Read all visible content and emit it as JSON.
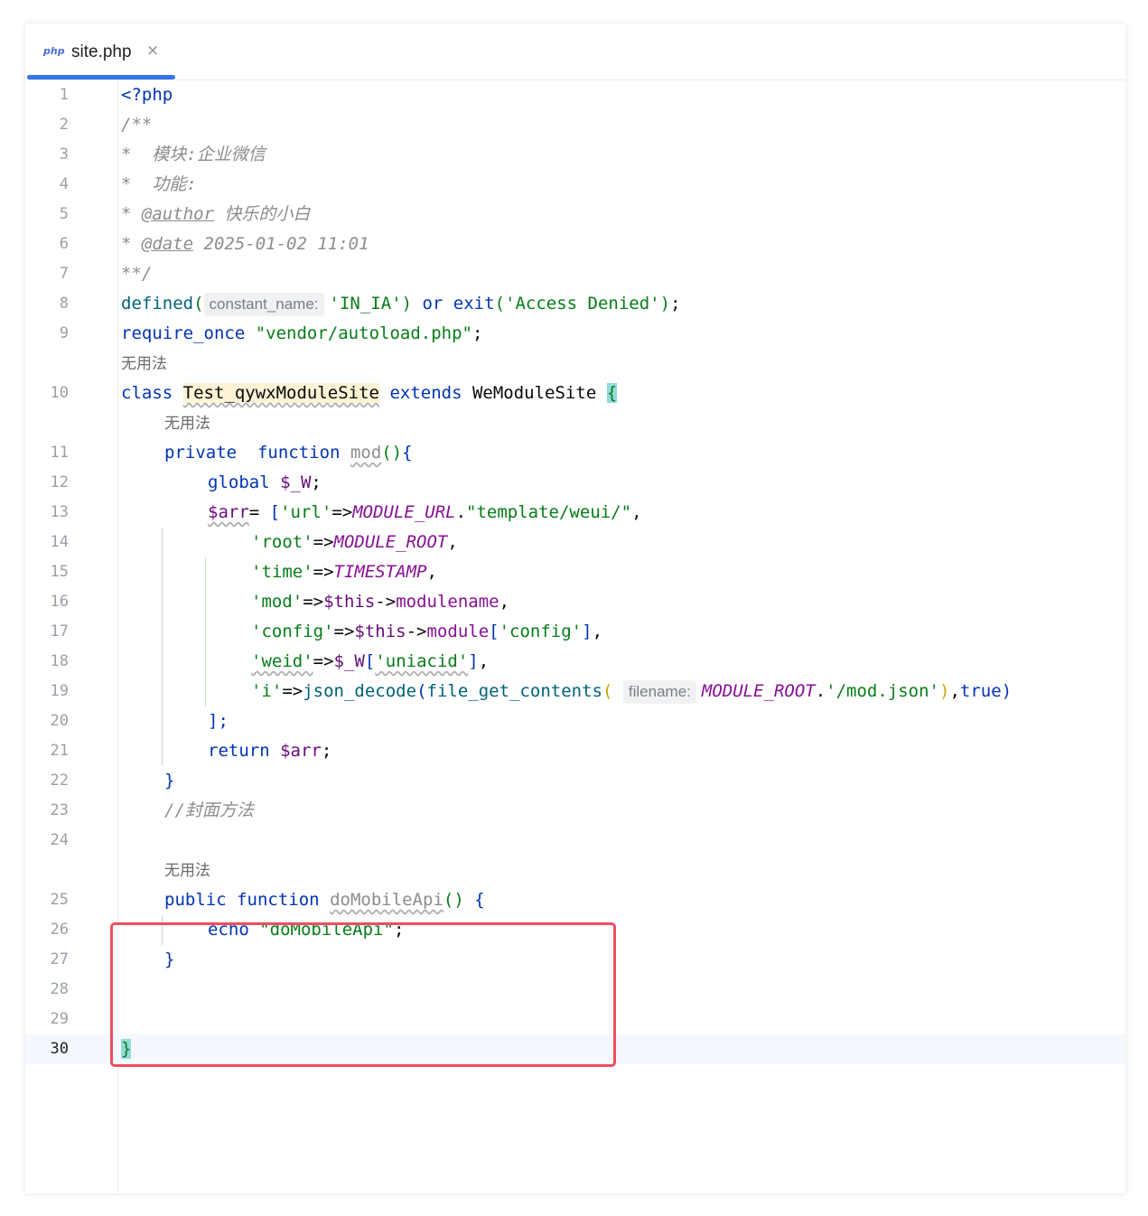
{
  "tab": {
    "icon": "php",
    "icon_name": "php-file-icon",
    "label": "site.php",
    "close": "×"
  },
  "usage_hint": "无用法",
  "hints": {
    "constant_name": "constant_name:",
    "filename": "filename:"
  },
  "line_numbers": [
    "1",
    "2",
    "3",
    "4",
    "5",
    "6",
    "7",
    "8",
    "9",
    "10",
    "11",
    "12",
    "13",
    "14",
    "15",
    "16",
    "17",
    "18",
    "19",
    "20",
    "21",
    "22",
    "23",
    "24",
    "25",
    "26",
    "27",
    "28",
    "29",
    "30"
  ],
  "code": {
    "l1": "<?php",
    "l2": "/**",
    "l3": "*  模块:企业微信",
    "l4": "*  功能:",
    "l5_star": "* ",
    "l5_tag": "@author",
    "l5_val": " 快乐的小白",
    "l6_star": "* ",
    "l6_tag": "@date",
    "l6_val": " 2025-01-02 11:01",
    "l7": "**/",
    "l8_fn": "defined",
    "l8_arg": "'IN_IA'",
    "l8_or": " or ",
    "l8_exit": "exit",
    "l8_msg": "'Access Denied'",
    "l9_kw": "require_once",
    "l9_str": "\"vendor/autoload.php\"",
    "l10_kw": "class",
    "l10_name": "Test_qywxModuleSite",
    "l10_ext": "extends",
    "l10_parent": "WeModuleSite",
    "l11_private": "private",
    "l11_function": "function",
    "l11_name": "mod",
    "l12_global": "global",
    "l12_var": "$_W",
    "l13_var": "$arr",
    "l13_key": "'url'",
    "l13_const": "MODULE_URL",
    "l13_str": "\"template/weui/\"",
    "l14_key": "'root'",
    "l14_const": "MODULE_ROOT",
    "l15_key": "'time'",
    "l15_const": "TIMESTAMP",
    "l16_key": "'mod'",
    "l16_this": "$this",
    "l16_prop": "modulename",
    "l17_key": "'config'",
    "l17_this": "$this",
    "l17_prop": "module",
    "l17_idx": "'config'",
    "l18_key": "'weid'",
    "l18_var": "$_W",
    "l18_idx": "'uniacid'",
    "l19_key": "'i'",
    "l19_fn1": "json_decode",
    "l19_fn2": "file_get_contents",
    "l19_const": "MODULE_ROOT",
    "l19_str": "'/mod.json'",
    "l19_true": "true",
    "l20": "];",
    "l21_kw": "return",
    "l21_var": "$arr",
    "l22": "}",
    "l23": "//封面方法",
    "l25_public": "public",
    "l25_function": "function",
    "l25_name": "doMobileApi",
    "l26_kw": "echo",
    "l26_str": "\"doMobileApi\"",
    "l27": "}",
    "l30": "}"
  }
}
